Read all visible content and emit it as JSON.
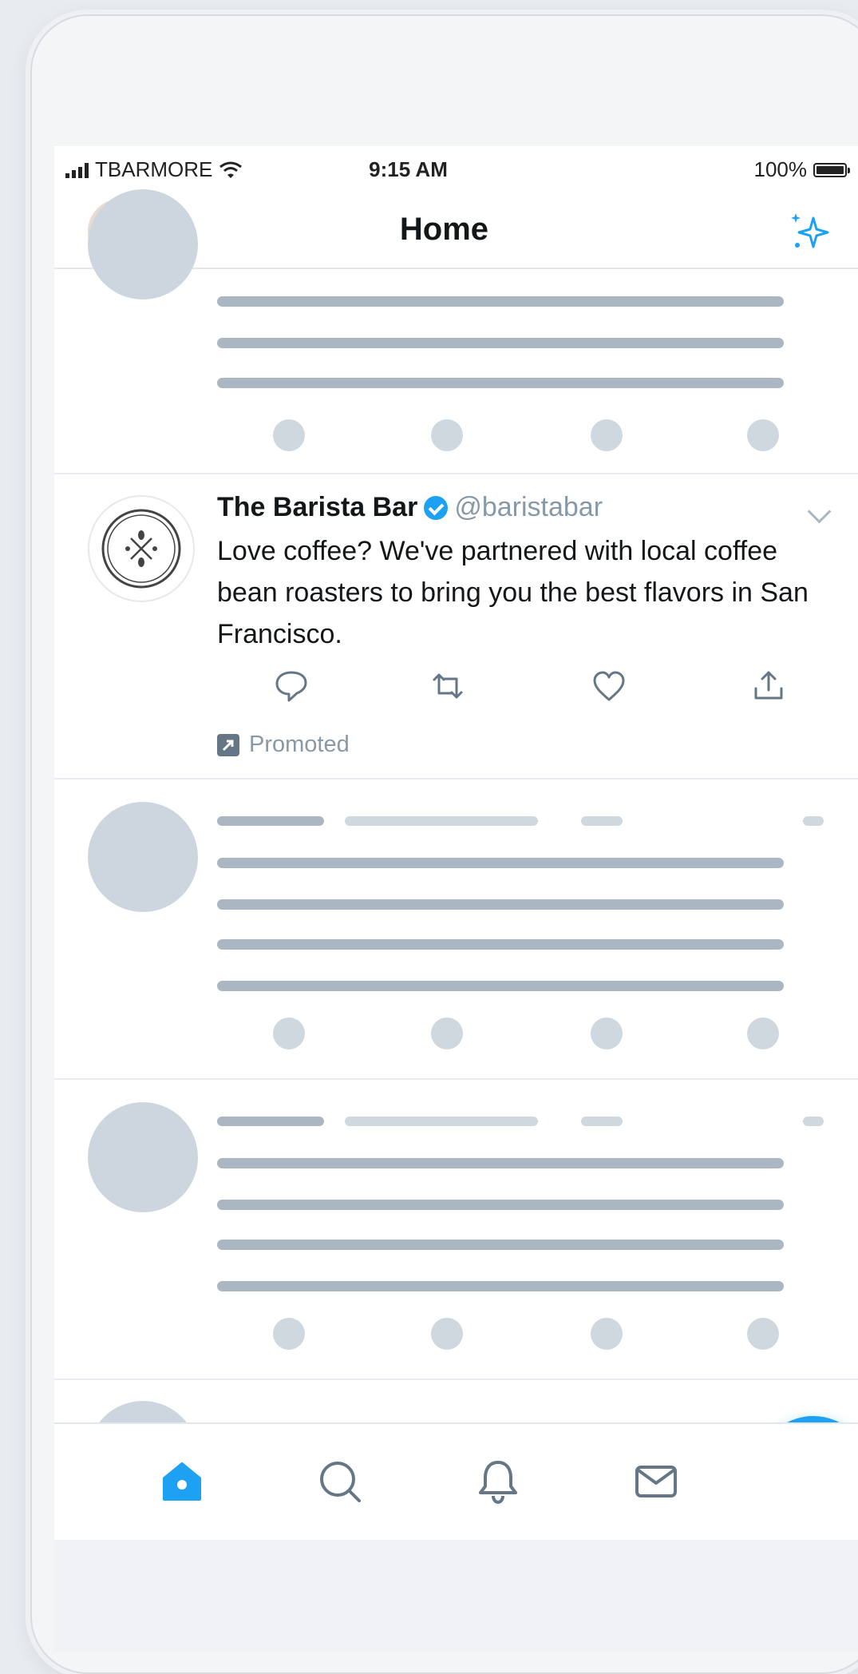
{
  "status_bar": {
    "carrier": "TBARMORE",
    "time": "9:15 AM",
    "battery": "100%"
  },
  "header": {
    "title": "Home",
    "profile_icon": "avatar",
    "action_icon": "sparkle-icon"
  },
  "tweet": {
    "name": "The Barista Bar",
    "handle": "@baristabar",
    "verified": true,
    "text": "Love coffee? We've partnered with local coffee bean roasters to bring you the best flavors in San Francisco.",
    "promoted_label": "Promoted",
    "actions": [
      "reply-icon",
      "retweet-icon",
      "like-icon",
      "share-icon"
    ]
  },
  "tabbar": {
    "items": [
      "home-icon",
      "search-icon",
      "notifications-icon",
      "messages-icon"
    ],
    "active": "home-icon"
  },
  "compose_button": {
    "icon": "compose-tweet-icon"
  },
  "colors": {
    "accent": "#1da1f2",
    "text": "#14171a",
    "secondary_text": "#8899a6",
    "skeleton_dark": "#aab7c3",
    "skeleton_light": "#cdd6de"
  }
}
